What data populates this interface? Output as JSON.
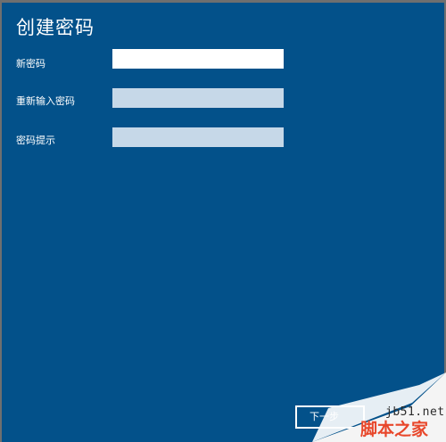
{
  "page_title": "创建密码",
  "fields": [
    {
      "label": "新密码",
      "value": ""
    },
    {
      "label": "重新输入密码",
      "value": ""
    },
    {
      "label": "密码提示",
      "value": ""
    }
  ],
  "next_button_label": "下一步",
  "watermark": {
    "site": "jb51.net",
    "brand": "脚本之家"
  },
  "colors": {
    "background": "#03518a",
    "input_active": "#ffffff",
    "input_inactive": "#c6d8e8",
    "watermark_red": "#e8472b"
  }
}
